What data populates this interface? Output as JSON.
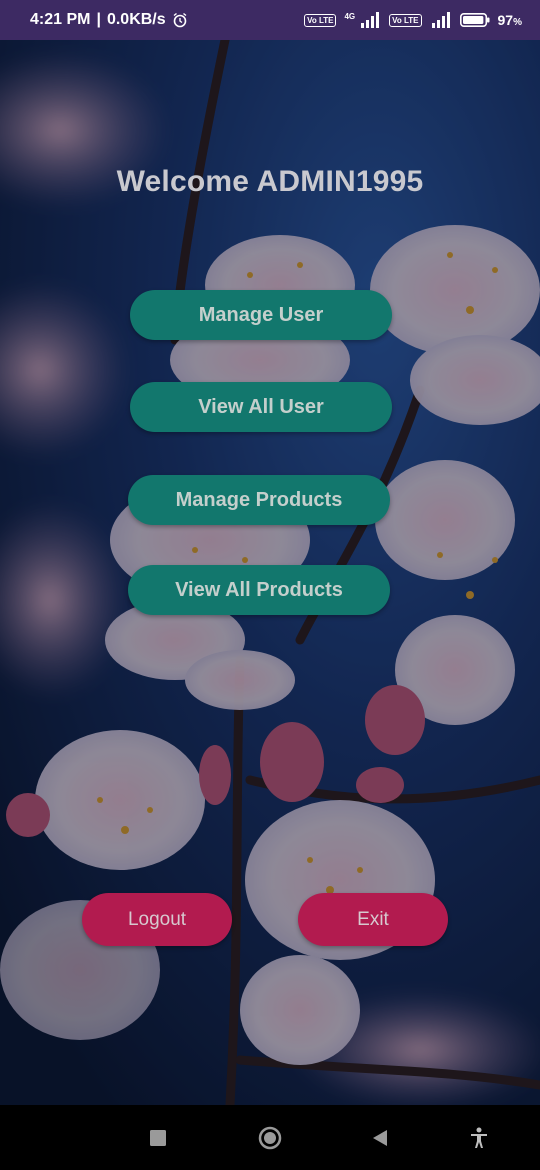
{
  "status_bar": {
    "time": "4:21 PM",
    "speed": "0.0KB/s",
    "sim1_volte": "Vo LTE",
    "network": "4G",
    "sim2_volte": "Vo LTE",
    "battery": "97",
    "battery_unit": "%",
    "battery_level": 0.97,
    "icons": [
      "alarm-icon",
      "volte-icon",
      "signal-icon",
      "volte-icon",
      "signal-icon",
      "battery-icon"
    ]
  },
  "main": {
    "welcome_text": "Welcome ADMIN1995",
    "menu": [
      {
        "label": "Manage User"
      },
      {
        "label": "View All User"
      },
      {
        "label": "Manage Products"
      },
      {
        "label": "View All Products"
      }
    ],
    "logout_label": "Logout",
    "exit_label": "Exit"
  },
  "nav_bar": {
    "icons": [
      "recents-square-icon",
      "home-circle-icon",
      "back-triangle-icon",
      "accessibility-icon"
    ]
  },
  "colors": {
    "status_bar": "#3d2a63",
    "menu_button": "#12776d",
    "action_button": "#b21b4f",
    "nav_bar": "#000000"
  }
}
